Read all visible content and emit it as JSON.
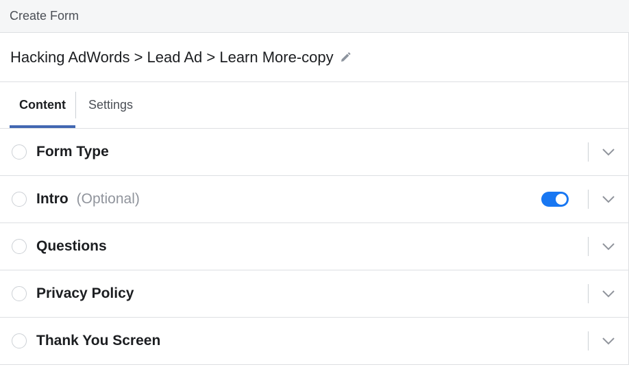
{
  "header": {
    "title": "Create Form"
  },
  "breadcrumb": {
    "text": "Hacking AdWords > Lead Ad > Learn More-copy"
  },
  "tabs": [
    {
      "label": "Content",
      "active": true
    },
    {
      "label": "Settings",
      "active": false
    }
  ],
  "sections": [
    {
      "title": "Form Type"
    },
    {
      "title": "Intro",
      "optional": "(Optional)",
      "toggle_on": true
    },
    {
      "title": "Questions"
    },
    {
      "title": "Privacy Policy"
    },
    {
      "title": "Thank You Screen"
    }
  ],
  "colors": {
    "accent": "#4267b2",
    "toggle": "#1877f2",
    "header_bg": "#f5f6f7"
  },
  "icons": {
    "edit": "pencil-icon",
    "expand": "chevron-down-icon"
  }
}
